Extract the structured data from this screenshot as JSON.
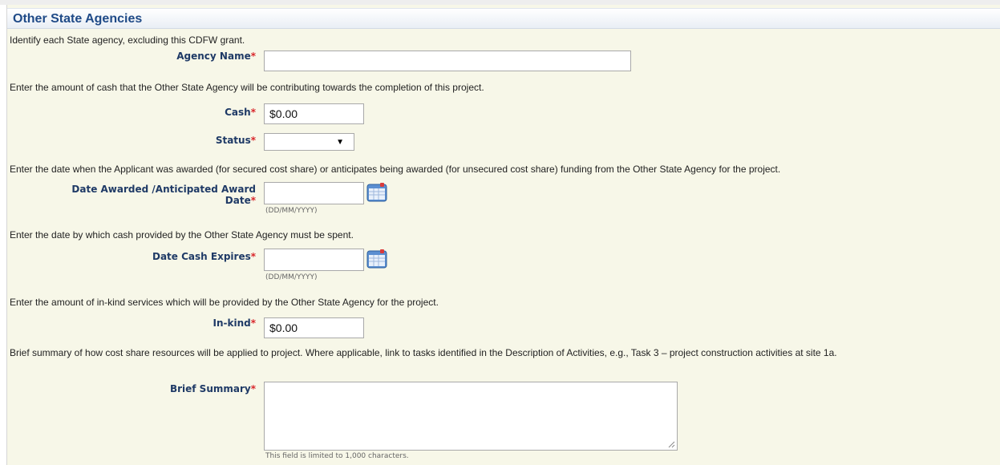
{
  "section": {
    "title": "Other State Agencies"
  },
  "instructions": {
    "agency": "Identify each State agency, excluding this CDFW grant.",
    "cash": "Enter the amount of cash that the Other State Agency will be contributing towards the completion of this project.",
    "date_awarded": "Enter the date when the Applicant was awarded (for secured cost share) or anticipates being awarded (for unsecured cost share) funding from the Other State Agency for the project.",
    "date_expires": "Enter the date by which cash provided by the Other State Agency must be spent.",
    "inkind": "Enter the amount of in-kind services which will be provided by the Other State Agency for the project.",
    "summary": "Brief summary of how cost share resources will be applied to project. Where applicable, link to tasks identified in the Description of Activities, e.g., Task 3 – project construction activities at site 1a."
  },
  "required_marker": "*",
  "fields": {
    "agency_name": {
      "label": "Agency Name",
      "value": ""
    },
    "cash": {
      "label": "Cash",
      "value": "$0.00"
    },
    "status": {
      "label": "Status",
      "value": ""
    },
    "date_awarded": {
      "label_line1": "Date Awarded /Anticipated Award",
      "label_line2": "Date",
      "value": "",
      "format_hint": "(DD/MM/YYYY)"
    },
    "date_expires": {
      "label": "Date Cash Expires",
      "value": "",
      "format_hint": "(DD/MM/YYYY)"
    },
    "inkind": {
      "label": "In-kind",
      "value": "$0.00"
    },
    "brief_summary": {
      "label": "Brief Summary",
      "value": "",
      "limit_note": "This field is limited to 1,000 characters."
    }
  },
  "icons": {
    "calendar": "calendar-icon",
    "dropdown": "chevron-down-icon",
    "resize": "resize-grip-icon"
  },
  "colors": {
    "header_text": "#1f4a87",
    "label_text": "#1f3a66",
    "required": "#d8262b",
    "panel_bg": "#f7f7e8"
  }
}
